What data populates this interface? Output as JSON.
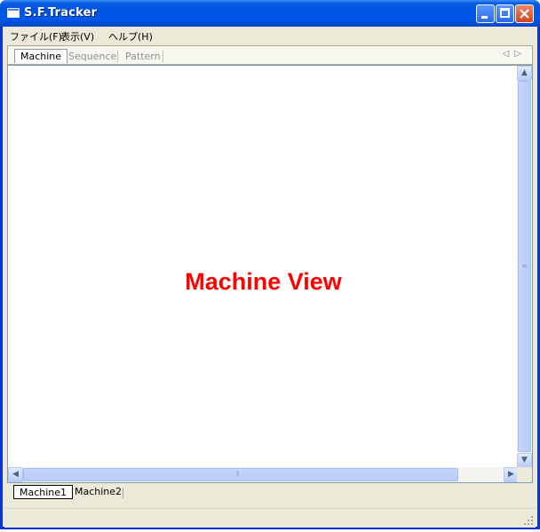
{
  "window": {
    "title": "S.F.Tracker"
  },
  "menu": {
    "file": "ファイル(F)",
    "view": "表示(V)",
    "help": "ヘルプ(H)"
  },
  "tabs": [
    {
      "label": "Machine",
      "active": true
    },
    {
      "label": "Sequence",
      "active": false
    },
    {
      "label": "Pattern",
      "active": false
    }
  ],
  "view": {
    "label": "Machine View",
    "label_color": "#ff0000"
  },
  "machine_tabs": [
    {
      "label": "Machine1",
      "active": true
    },
    {
      "label": "Machine2",
      "active": false
    }
  ],
  "colors": {
    "titlebar": "#0054e3",
    "window_bg": "#ece9d8",
    "close_button": "#d6441e"
  },
  "icons": {
    "app": "window-icon",
    "minimize": "minimize-icon",
    "maximize": "maximize-icon",
    "close": "close-icon",
    "tab_prev": "triangle-left-icon",
    "tab_next": "triangle-right-icon",
    "scroll_up": "arrow-up-icon",
    "scroll_down": "arrow-down-icon",
    "scroll_left": "arrow-left-icon",
    "scroll_right": "arrow-right-icon",
    "resize": "resize-grip-icon"
  }
}
